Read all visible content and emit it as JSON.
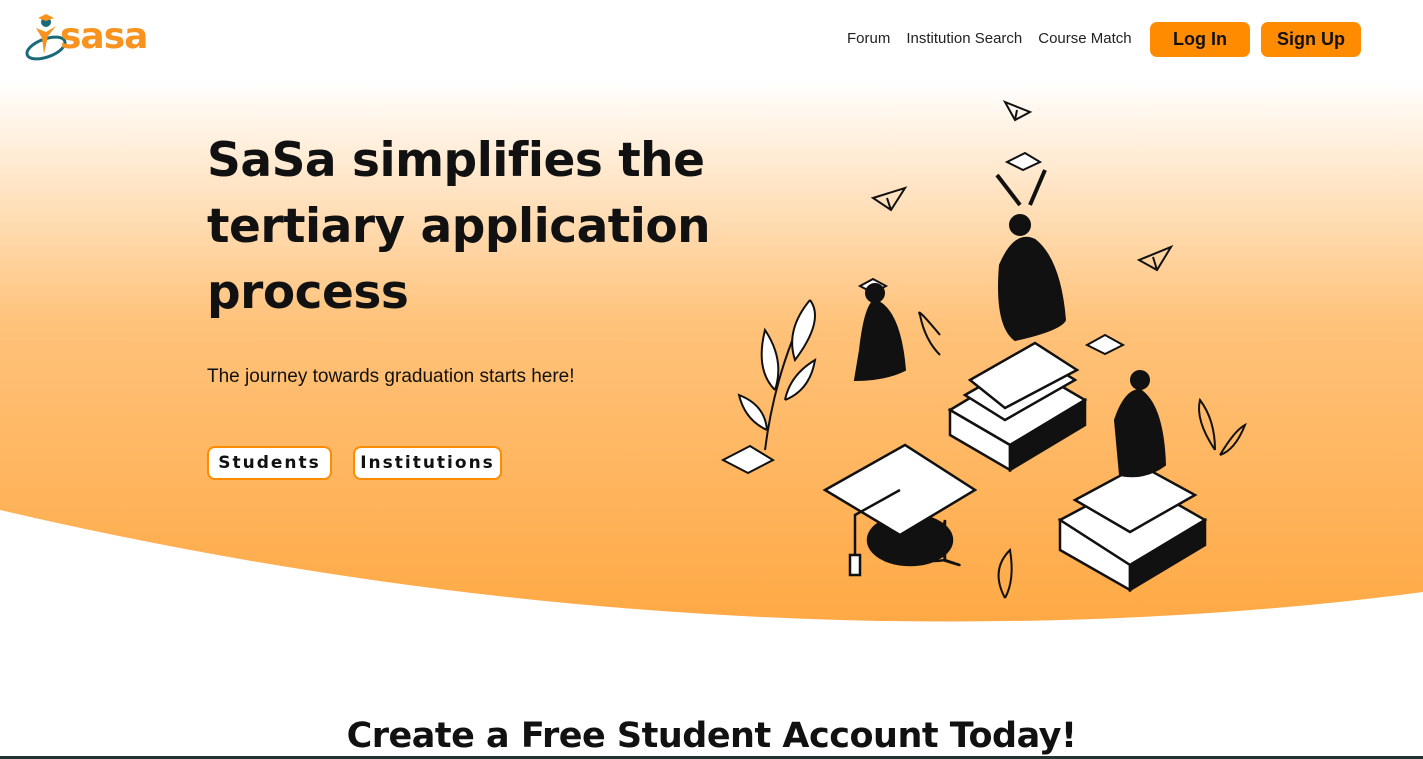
{
  "brand": {
    "logo_text": "sasa",
    "accent": "#ff8c00",
    "logo_color": "#f7931e",
    "logo_ring_color": "#1a6b7a"
  },
  "nav": {
    "links": [
      "Forum",
      "Institution Search",
      "Course Match"
    ],
    "login_label": "Log In",
    "signup_label": "Sign Up"
  },
  "hero": {
    "title": "SaSa simplifies the tertiary application process",
    "subtitle": "The journey towards graduation starts here!",
    "students_label": "Students",
    "institutions_label": "Institutions",
    "illustration": "graduates-celebrating-illustration"
  },
  "section": {
    "title": "Create a Free Student Account Today!"
  }
}
